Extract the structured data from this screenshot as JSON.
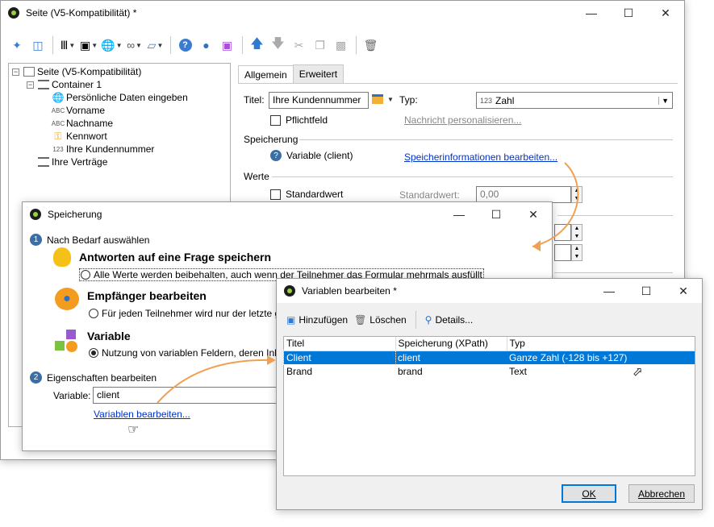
{
  "main_window": {
    "title": "Seite (V5-Kompatibilität) *",
    "tabs": [
      "Allgemein",
      "Erweitert"
    ],
    "tree": [
      {
        "label": "Seite (V5-Kompatibilität)",
        "icon": "page-icon"
      },
      {
        "label": "Container 1",
        "icon": "container-icon"
      },
      {
        "label": "Persönliche Daten eingeben",
        "icon": "globe-icon"
      },
      {
        "label": "Vorname",
        "icon": "abc-icon"
      },
      {
        "label": "Nachname",
        "icon": "abc-icon"
      },
      {
        "label": "Kennwort",
        "icon": "key-icon"
      },
      {
        "label": "Ihre Kundennummer",
        "icon": "number-icon"
      },
      {
        "label": "Ihre Verträge",
        "icon": "container-icon"
      }
    ],
    "tree_icon_text": {
      "abc": "ABC",
      "num": "123"
    },
    "form": {
      "title_label": "Titel:",
      "title_value": "Ihre Kundennummer",
      "type_label": "Typ:",
      "type_prefix": "123",
      "type_value": "Zahl",
      "required_label": "Pflichtfeld",
      "personalize_link": "Nachricht personalisieren...",
      "storage_section": "Speicherung",
      "storage_value": "Variable (client)",
      "storage_link": "Speicherinformationen bearbeiten...",
      "values_section": "Werte",
      "default_label": "Standardwert",
      "default_value_label": "Standardwert:",
      "default_value": "0,00"
    }
  },
  "storage_dialog": {
    "title": "Speicherung",
    "step1": {
      "num": "1",
      "label": "Nach Bedarf auswählen"
    },
    "options": [
      {
        "title": "Antworten auf eine Frage speichern",
        "desc": "Alle Werte werden beibehalten, auch wenn der Teilnehmer das Formular mehrmals ausfüllt",
        "selected": false
      },
      {
        "title": "Empfänger bearbeiten",
        "desc": "Für jeden Teilnehmer wird nur der letzte g",
        "selected": false
      },
      {
        "title": "Variable",
        "desc": "Nutzung von variablen Feldern, deren Inh",
        "selected": true
      }
    ],
    "step2": {
      "num": "2",
      "label": "Eigenschaften bearbeiten"
    },
    "variable_label": "Variable:",
    "variable_value": "client",
    "edit_link": "Variablen bearbeiten..."
  },
  "variables_dialog": {
    "title": "Variablen bearbeiten *",
    "toolbar": {
      "add": "Hinzufügen",
      "delete": "Löschen",
      "details": "Details..."
    },
    "columns": [
      "Titel",
      "Speicherung (XPath)",
      "Typ"
    ],
    "rows": [
      {
        "title": "Client",
        "xpath": "client",
        "type": "Ganze Zahl (-128 bis +127)",
        "selected": true
      },
      {
        "title": "Brand",
        "xpath": "brand",
        "type": "Text",
        "selected": false
      }
    ],
    "ok": "OK",
    "cancel": "Abbrechen"
  },
  "colors": {
    "accent": "#0078d7",
    "link": "#0033cc",
    "arrow": "#f0a050",
    "selected_row": "#0078d7"
  }
}
